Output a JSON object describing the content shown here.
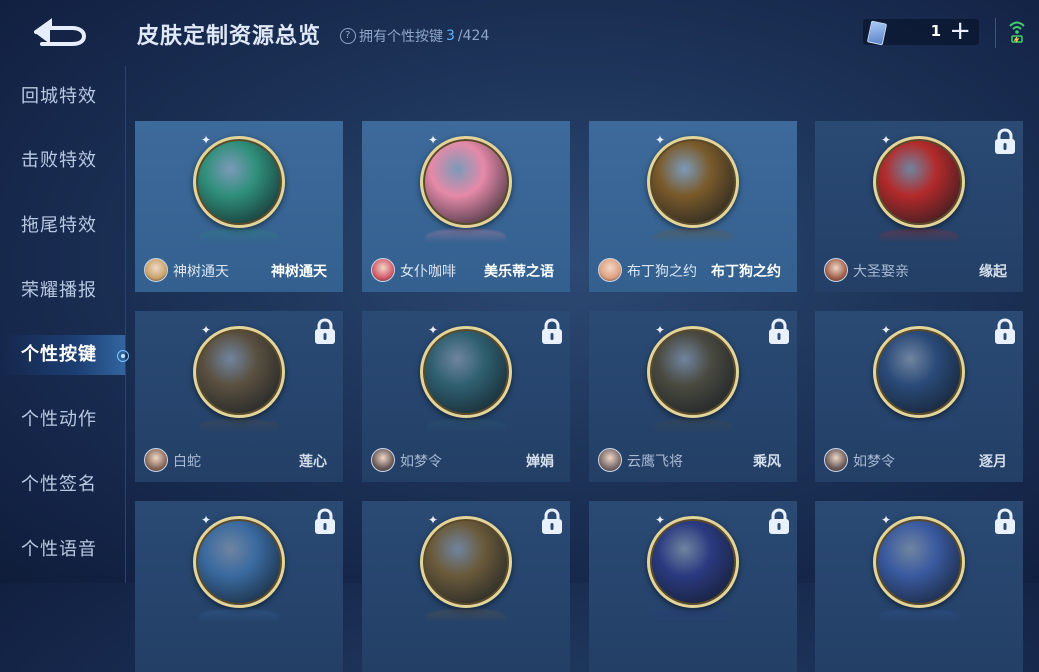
{
  "header": {
    "title": "皮肤定制资源总览",
    "subtitle_prefix": "拥有个性按键",
    "owned_count": "3",
    "total": "/424",
    "currency_amount": "1",
    "plus_label": "+"
  },
  "sidebar": {
    "items": [
      {
        "label": "回城特效"
      },
      {
        "label": "击败特效"
      },
      {
        "label": "拖尾特效"
      },
      {
        "label": "荣耀播报"
      },
      {
        "label": "个性按键"
      },
      {
        "label": "个性动作"
      },
      {
        "label": "个性签名"
      },
      {
        "label": "个性语音"
      }
    ]
  },
  "cards": [
    {
      "hero": "神树通天",
      "skin": "神树通天",
      "locked": false,
      "medal_color": "#2f8f7a",
      "avatar_color": "#c9a36a"
    },
    {
      "hero": "女仆咖啡",
      "skin": "美乐蒂之语",
      "locked": false,
      "medal_color": "#e58aa8",
      "avatar_color": "#d25a6a"
    },
    {
      "hero": "布丁狗之约",
      "skin": "布丁狗之约",
      "locked": false,
      "medal_color": "#7a5a2a",
      "avatar_color": "#e0a080"
    },
    {
      "hero": "大圣娶亲",
      "skin": "缘起",
      "locked": true,
      "medal_color": "#b32a2a",
      "avatar_color": "#a0604a"
    },
    {
      "hero": "白蛇",
      "skin": "莲心",
      "locked": true,
      "medal_color": "#5a5040",
      "avatar_color": "#8a6a5a"
    },
    {
      "hero": "如梦令",
      "skin": "婵娟",
      "locked": true,
      "medal_color": "#2f6070",
      "avatar_color": "#6a5a5a"
    },
    {
      "hero": "云鹰飞将",
      "skin": "乘风",
      "locked": true,
      "medal_color": "#4a4a40",
      "avatar_color": "#7a6a6a"
    },
    {
      "hero": "如梦令",
      "skin": "逐月",
      "locked": true,
      "medal_color": "#2a4a78",
      "avatar_color": "#6a5a5a"
    },
    {
      "hero": "",
      "skin": "",
      "locked": true,
      "medal_color": "#3a6aa0",
      "avatar_color": "#6a6a7a"
    },
    {
      "hero": "",
      "skin": "",
      "locked": true,
      "medal_color": "#6a5a3a",
      "avatar_color": "#6a6a7a"
    },
    {
      "hero": "",
      "skin": "",
      "locked": true,
      "medal_color": "#2a3a80",
      "avatar_color": "#6a6a7a"
    },
    {
      "hero": "",
      "skin": "",
      "locked": true,
      "medal_color": "#3a5aa0",
      "avatar_color": "#6a6a7a"
    }
  ],
  "icons": {
    "back": "back-arrow-icon",
    "help": "question-icon",
    "currency": "coupon-card-icon",
    "wifi": "wifi-icon",
    "lock": "lock-icon"
  },
  "colors": {
    "accent": "#5cb4ff",
    "active_tab": "#3a8ef0"
  }
}
